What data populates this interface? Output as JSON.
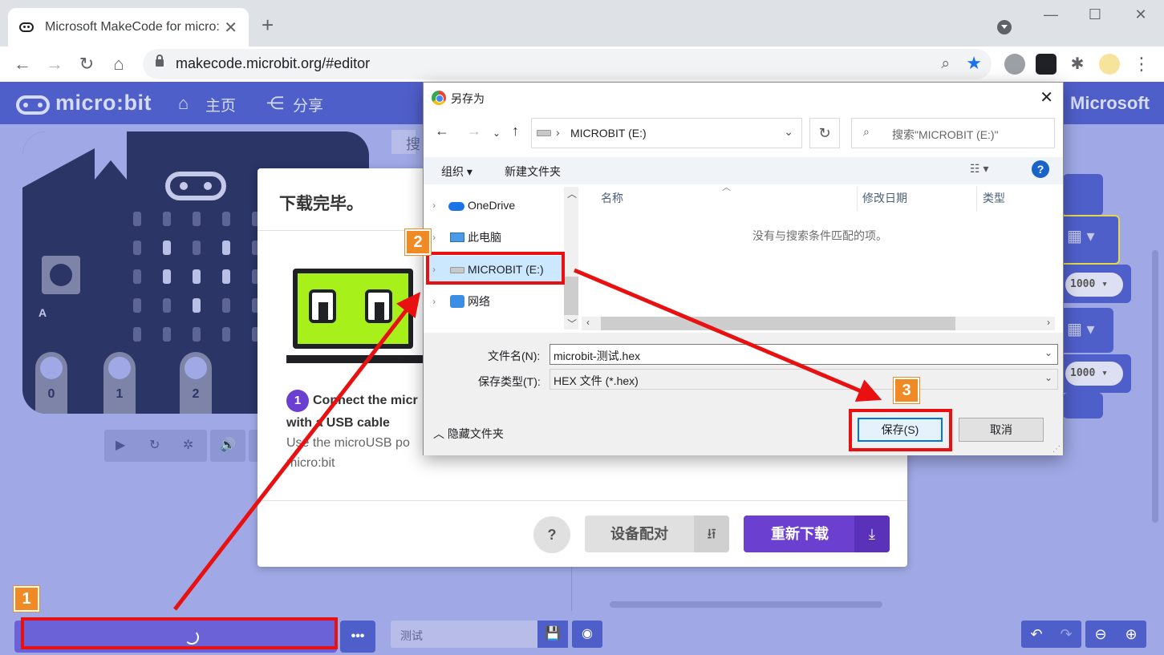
{
  "browser": {
    "tab_title": "Microsoft MakeCode for micro:bit",
    "tab_title_visible": "Microsoft MakeCode for micro",
    "url": "makecode.microbit.org/#editor",
    "icons": [
      "back-icon",
      "forward-icon",
      "reload-icon",
      "home-icon",
      "lock-icon",
      "zoom-icon",
      "star-icon",
      "extensions-icon",
      "profile-icon",
      "menu-icon"
    ]
  },
  "makecode": {
    "logo": "micro:bit",
    "nav": {
      "home": "主页",
      "share": "分享"
    },
    "brand": "Microsoft",
    "pins": [
      "0",
      "1",
      "2"
    ],
    "button_a": "A",
    "blocks": {
      "pause_value_1": "1000",
      "pause_value_2": "1000"
    },
    "search_placeholder_partial": "搜",
    "project_name_placeholder": "测试",
    "accent_color": "#4f5fc9"
  },
  "download_dialog": {
    "title": "下载完毕。",
    "step_number": "1",
    "step_title": "Connect the micr",
    "step_title_line2": "with a USB cable",
    "step_desc": "Use the microUSB po",
    "step_desc_line2": "micro:bit",
    "help_label": "?",
    "pair_label": "设备配对",
    "pair_icon": "⭿",
    "redownload_label": "重新下载",
    "purple": "#6b3fd0"
  },
  "save_dialog": {
    "title": "另存为",
    "path": "MICROBIT (E:)",
    "search_placeholder": "搜索\"MICROBIT (E:)\"",
    "organize": "组织 ▾",
    "new_folder": "新建文件夹",
    "nav_items": [
      {
        "label": "OneDrive"
      },
      {
        "label": "此电脑"
      },
      {
        "label": "MICROBIT (E:)",
        "selected": true
      },
      {
        "label": "网络"
      }
    ],
    "columns": {
      "name": "名称",
      "modified": "修改日期",
      "type": "类型"
    },
    "empty_message": "没有与搜索条件匹配的项。",
    "filename_label": "文件名(N):",
    "filename_value": "microbit-测试.hex",
    "filetype_label": "保存类型(T):",
    "filetype_value": "HEX 文件 (*.hex)",
    "hide_folders": "隐藏文件夹",
    "save_button": "保存(S)",
    "cancel_button": "取消"
  },
  "annotations": {
    "badges": [
      "1",
      "2",
      "3"
    ],
    "color": "#e81010",
    "badge_color": "#f08a24"
  }
}
